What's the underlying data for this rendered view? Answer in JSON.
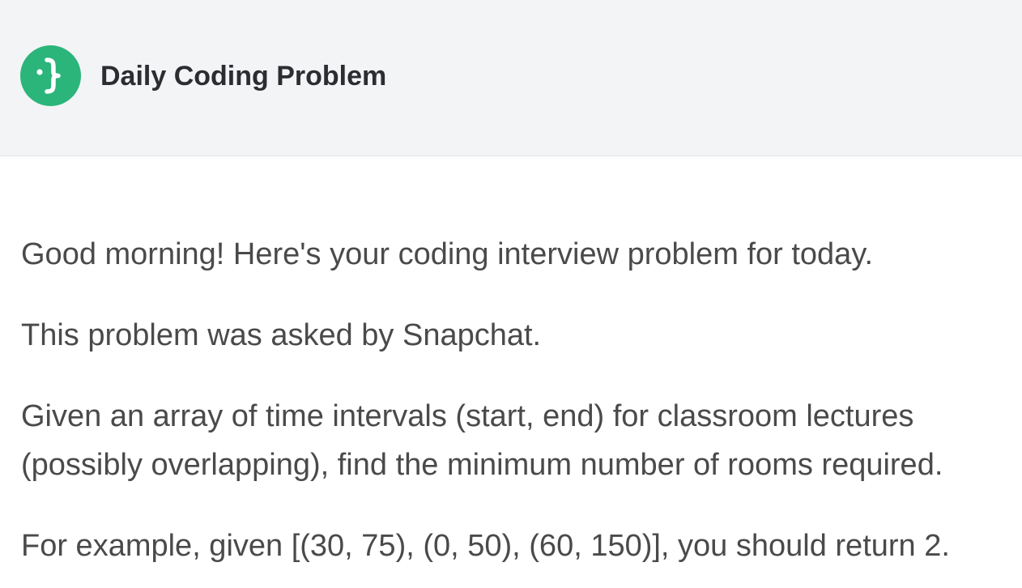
{
  "header": {
    "brand_name": "Daily Coding Problem",
    "logo_icon": "curly-brace-face-icon",
    "accent_color": "#2bb57a"
  },
  "email": {
    "greeting": "Good morning! Here's your coding interview problem for today.",
    "asked_by": "This problem was asked by Snapchat.",
    "problem": "Given an array of time intervals (start, end) for classroom lectures (possibly overlapping), find the minimum number of rooms required.",
    "example": "For example, given [(30, 75), (0, 50), (60, 150)], you should return 2."
  }
}
